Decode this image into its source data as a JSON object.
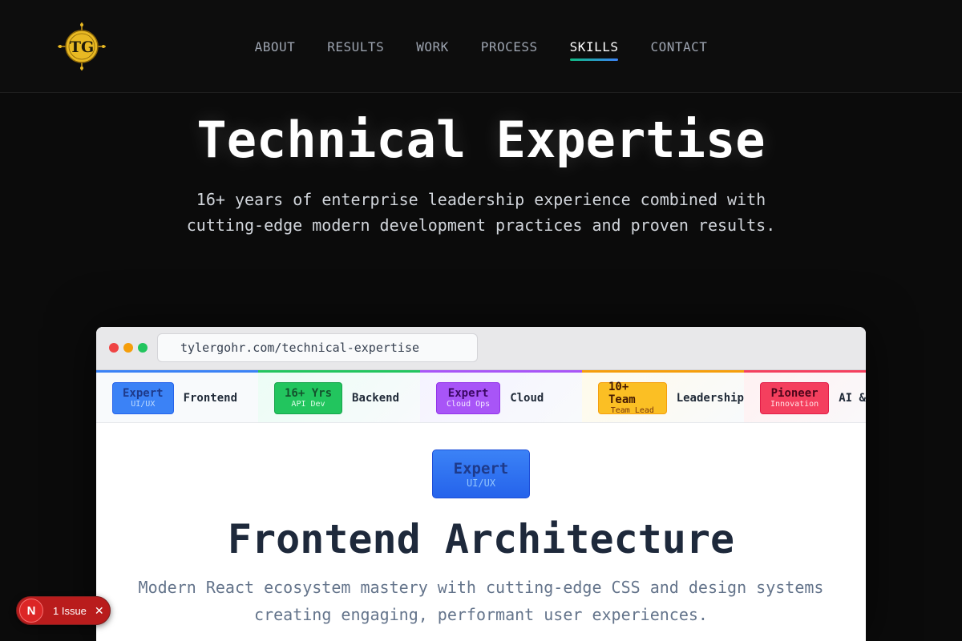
{
  "header": {
    "logo_text": "TG",
    "nav": [
      {
        "label": "ABOUT",
        "active": false
      },
      {
        "label": "RESULTS",
        "active": false
      },
      {
        "label": "WORK",
        "active": false
      },
      {
        "label": "PROCESS",
        "active": false
      },
      {
        "label": "SKILLS",
        "active": true
      },
      {
        "label": "CONTACT",
        "active": false
      }
    ]
  },
  "hero": {
    "title": "Technical Expertise",
    "subtitle": "16+ years of enterprise leadership experience combined with cutting-edge modern development practices and proven results."
  },
  "browser": {
    "url": "tylergohr.com/technical-expertise",
    "tabs": [
      {
        "badge_main": "Expert",
        "badge_sub": "UI/UX",
        "label": "Frontend",
        "color": "#3b82f6"
      },
      {
        "badge_main": "16+ Yrs",
        "badge_sub": "API Dev",
        "label": "Backend",
        "color": "#22c55e"
      },
      {
        "badge_main": "Expert",
        "badge_sub": "Cloud Ops",
        "label": "Cloud",
        "color": "#a855f7"
      },
      {
        "badge_main": "10+ Team",
        "badge_sub": "Team Lead",
        "label": "Leadership",
        "color": "#f59e0b"
      },
      {
        "badge_main": "Pioneer",
        "badge_sub": "Innovation",
        "label": "AI &",
        "color": "#f43f5e"
      }
    ],
    "content": {
      "badge_main": "Expert",
      "badge_sub": "UI/UX",
      "title": "Frontend Architecture",
      "description": "Modern React ecosystem mastery with cutting-edge CSS and design systems creating engaging, performant user experiences."
    }
  },
  "issue_pill": {
    "icon_letter": "N",
    "text": "1 Issue",
    "close": "✕"
  }
}
